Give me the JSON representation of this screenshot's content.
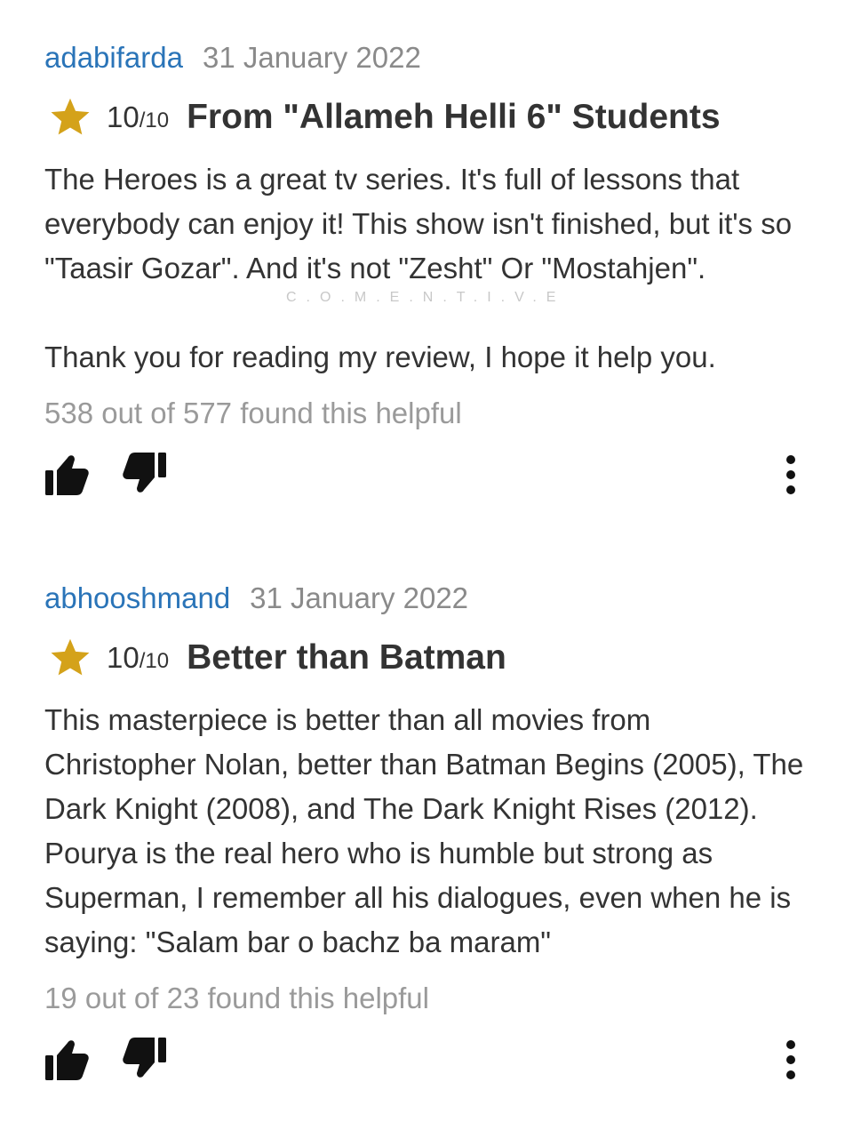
{
  "reviews": [
    {
      "author": "adabifarda",
      "date": "31 January 2022",
      "rating": "10",
      "rating_max": "/10",
      "title": "From \"Allameh Helli 6\" Students",
      "paragraphs": [
        "The Heroes is a great tv series. It's full of lessons that everybody can enjoy it! This show isn't finished, but it's so \"Taasir Gozar\". And it's not \"Zesht\" Or \"Mostahjen\".",
        "Thank you for reading my review, I hope it help you."
      ],
      "helpful": "538 out of 577 found this helpful"
    },
    {
      "author": "abhooshmand",
      "date": "31 January 2022",
      "rating": "10",
      "rating_max": "/10",
      "title": "Better than Batman",
      "paragraphs": [
        "This masterpiece is better than all movies from Christopher Nolan, better than Batman Begins (2005), The Dark Knight (2008), and The Dark Knight Rises (2012). Pourya is the real hero who is humble but strong as Superman, I remember all his dialogues, even when he is saying: \"Salam bar o bachz ba maram\""
      ],
      "helpful": "19 out of 23 found this helpful"
    }
  ],
  "watermark": "C.O.M.E.N.T.I.V.E",
  "icons": {
    "star": "star-icon",
    "thumbs_up": "thumbs-up-icon",
    "thumbs_down": "thumbs-down-icon",
    "more": "more-vertical-icon"
  },
  "colors": {
    "author_link": "#2a74b8",
    "star": "#d4a21a",
    "text": "#333333",
    "muted": "#9a9a9a"
  }
}
